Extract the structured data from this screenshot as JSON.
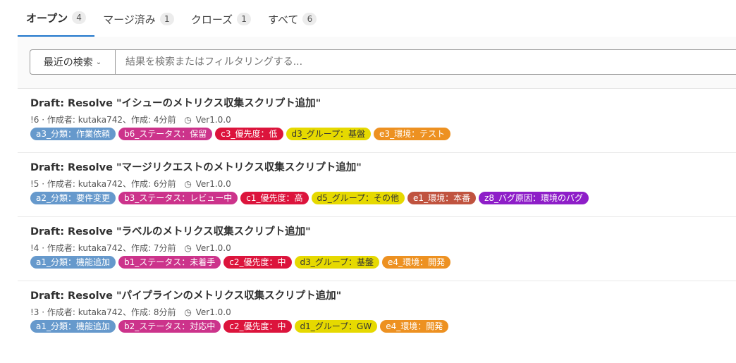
{
  "tabs": [
    {
      "label": "オープン",
      "count": "4",
      "active": true
    },
    {
      "label": "マージ済み",
      "count": "1",
      "active": false
    },
    {
      "label": "クローズ",
      "count": "1",
      "active": false
    },
    {
      "label": "すべて",
      "count": "6",
      "active": false
    }
  ],
  "filter": {
    "recent_label": "最近の検索",
    "search_placeholder": "結果を検索またはフィルタリングする..."
  },
  "merge_requests": [
    {
      "title": "Draft: Resolve \"イシューのメトリクス収集スクリプト追加\"",
      "meta": "!6 · 作成者: kutaka742、作成: 4分前",
      "milestone": "Ver1.0.0",
      "labels": [
        {
          "text": "a3_分類：作業依頼",
          "color": "#6699cc",
          "text_color": "#ffffff"
        },
        {
          "text": "b6_ステータス：保留",
          "color": "#cc338b",
          "text_color": "#ffffff"
        },
        {
          "text": "c3_優先度：低",
          "color": "#dc143c",
          "text_color": "#ffffff"
        },
        {
          "text": "d3_グループ：基盤",
          "color": "#e6d900",
          "text_color": "#333333"
        },
        {
          "text": "e3_環境：テスト",
          "color": "#ed9121",
          "text_color": "#ffffff"
        }
      ]
    },
    {
      "title": "Draft: Resolve \"マージリクエストのメトリクス収集スクリプト追加\"",
      "meta": "!5 · 作成者: kutaka742、作成: 6分前",
      "milestone": "Ver1.0.0",
      "labels": [
        {
          "text": "a2_分類：要件変更",
          "color": "#6699cc",
          "text_color": "#ffffff"
        },
        {
          "text": "b3_ステータス：レビュー中",
          "color": "#cc338b",
          "text_color": "#ffffff"
        },
        {
          "text": "c1_優先度：高",
          "color": "#dc143c",
          "text_color": "#ffffff"
        },
        {
          "text": "d5_グループ：その他",
          "color": "#e6d900",
          "text_color": "#333333"
        },
        {
          "text": "e1_環境：本番",
          "color": "#c0533f",
          "text_color": "#ffffff"
        },
        {
          "text": "z8_バグ原因：環境のバグ",
          "color": "#8e1ec8",
          "text_color": "#ffffff"
        }
      ]
    },
    {
      "title": "Draft: Resolve \"ラベルのメトリクス収集スクリプト追加\"",
      "meta": "!4 · 作成者: kutaka742、作成: 7分前",
      "milestone": "Ver1.0.0",
      "labels": [
        {
          "text": "a1_分類：機能追加",
          "color": "#6699cc",
          "text_color": "#ffffff"
        },
        {
          "text": "b1_ステータス：未着手",
          "color": "#cc338b",
          "text_color": "#ffffff"
        },
        {
          "text": "c2_優先度：中",
          "color": "#dc143c",
          "text_color": "#ffffff"
        },
        {
          "text": "d3_グループ：基盤",
          "color": "#e6d900",
          "text_color": "#333333"
        },
        {
          "text": "e4_環境：開発",
          "color": "#ed9121",
          "text_color": "#ffffff"
        }
      ]
    },
    {
      "title": "Draft: Resolve \"パイプラインのメトリクス収集スクリプト追加\"",
      "meta": "!3 · 作成者: kutaka742、作成: 8分前",
      "milestone": "Ver1.0.0",
      "labels": [
        {
          "text": "a1_分類：機能追加",
          "color": "#6699cc",
          "text_color": "#ffffff"
        },
        {
          "text": "b2_ステータス：対応中",
          "color": "#cc338b",
          "text_color": "#ffffff"
        },
        {
          "text": "c2_優先度：中",
          "color": "#dc143c",
          "text_color": "#ffffff"
        },
        {
          "text": "d1_グループ：GW",
          "color": "#e6d900",
          "text_color": "#333333"
        },
        {
          "text": "e4_環境：開発",
          "color": "#ed9121",
          "text_color": "#ffffff"
        }
      ]
    }
  ]
}
